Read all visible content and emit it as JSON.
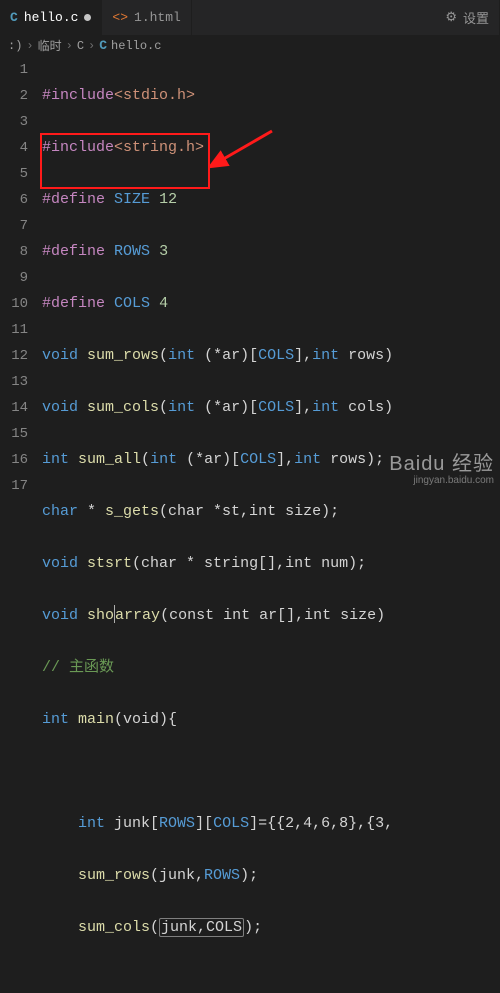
{
  "tabs": {
    "active": {
      "icon": "C",
      "label": "hello.c"
    },
    "other": {
      "icon": "<>",
      "label": "1.html"
    },
    "settings": {
      "icon": "⚙",
      "label": "设置"
    }
  },
  "breadcrumb": {
    "p0": ":)",
    "p1": "临时",
    "p2": "C",
    "p3": "hello.c",
    "icon": "C"
  },
  "code": {
    "l1": {
      "dir": "#include",
      "rest": "<stdio.h>"
    },
    "l2": {
      "dir": "#include",
      "rest": "<string.h>"
    },
    "l3": {
      "dir": "#define",
      "name": "SIZE",
      "val": "12"
    },
    "l4": {
      "dir": "#define",
      "name": "ROWS",
      "val": "3"
    },
    "l5": {
      "dir": "#define",
      "name": "COLS",
      "val": "4"
    },
    "l6": {
      "t": "void",
      "fn": "sum_rows",
      "sig_a": "int",
      "sig_b": "(*ar)[",
      "sig_c": "COLS",
      "sig_d": "],",
      "sig_e": "int",
      "sig_f": " rows)"
    },
    "l7": {
      "t": "void",
      "fn": "sum_cols",
      "sig_a": "int",
      "sig_b": "(*ar)[",
      "sig_c": "COLS",
      "sig_d": "],",
      "sig_e": "int",
      "sig_f": " cols)"
    },
    "l8": {
      "t": "int",
      "fn": "sum_all",
      "sig_a": "int",
      "sig_b": "(*ar)[",
      "sig_c": "COLS",
      "sig_d": "],",
      "sig_e": "int",
      "sig_f": " rows);"
    },
    "l9": {
      "t": "char",
      "star": " * ",
      "fn": "s_gets",
      "sig": "(char *st,int size);"
    },
    "l10": {
      "t": "void",
      "fn": "stsrt",
      "sig": "(char * string[],int num);"
    },
    "l11": {
      "t": "void",
      "fn": "sho",
      "fn2": "array",
      "sig": "(const int ar[],int size)"
    },
    "l12": {
      "c": "// 主函数"
    },
    "l13": {
      "t": "int",
      "fn": "main",
      "sig": "(void){"
    },
    "l14": "",
    "l15": {
      "t": "int",
      "id": " junk[",
      "m1": "ROWS",
      "mid": "][",
      "m2": "COLS",
      "tail": "]={{2,4,6,8},{3,"
    },
    "l16": {
      "fn": "sum_rows",
      "args_a": "(junk,",
      "args_b": "ROWS",
      "args_c": ");"
    },
    "l17": {
      "fn": "sum_cols",
      "args_a": "(",
      "args_b": "junk,COLS",
      "args_c": ");"
    }
  },
  "watermark": {
    "brand": "Baidu 经验",
    "url": "jingyan.baidu.com"
  }
}
